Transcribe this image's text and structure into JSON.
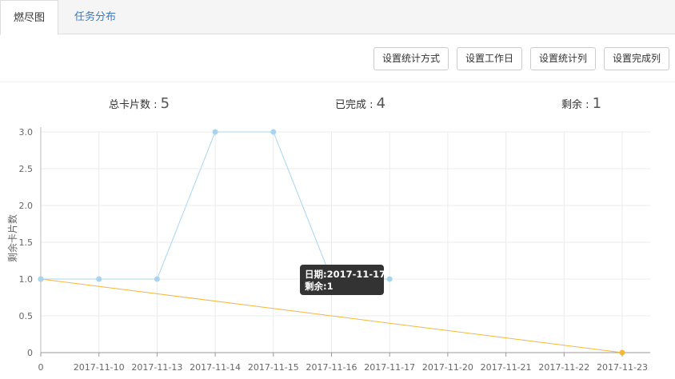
{
  "tabs": [
    {
      "label": "燃尽图",
      "active": true
    },
    {
      "label": "任务分布",
      "active": false
    }
  ],
  "toolbar": {
    "buttons": [
      "设置统计方式",
      "设置工作日",
      "设置统计列",
      "设置完成列"
    ]
  },
  "stats": {
    "total_label": "总卡片数 :",
    "total_value": "5",
    "done_label": "已完成 :",
    "done_value": "4",
    "remaining_label": "剩余 :",
    "remaining_value": "1"
  },
  "colors": {
    "actual_line": "#a8d4ef",
    "actual_point": "#a8d4ef",
    "ideal_line": "#f0b93a",
    "ideal_point": "#f0b93a",
    "tab_link": "#3a7bbf",
    "tooltip_bg": "#333333"
  },
  "tooltip": {
    "date_line": "日期:2017-11-17",
    "remaining_line": "剩余:1"
  },
  "chart_data": {
    "type": "line",
    "ylabel": "剩余卡片数",
    "ylim": [
      0,
      3.0
    ],
    "yticks": [
      "0",
      "0.5",
      "1.0",
      "1.5",
      "2.0",
      "2.5",
      "3.0"
    ],
    "categories": [
      "0",
      "2017-11-10",
      "2017-11-13",
      "2017-11-14",
      "2017-11-15",
      "2017-11-16",
      "2017-11-17",
      "2017-11-20",
      "2017-11-21",
      "2017-11-22",
      "2017-11-23"
    ],
    "grid": true,
    "series": [
      {
        "values": [
          1,
          1,
          1,
          3,
          3,
          1,
          1,
          null,
          null,
          null,
          null
        ]
      },
      {
        "values": [
          1,
          null,
          null,
          null,
          null,
          null,
          null,
          null,
          null,
          null,
          0
        ]
      }
    ]
  }
}
